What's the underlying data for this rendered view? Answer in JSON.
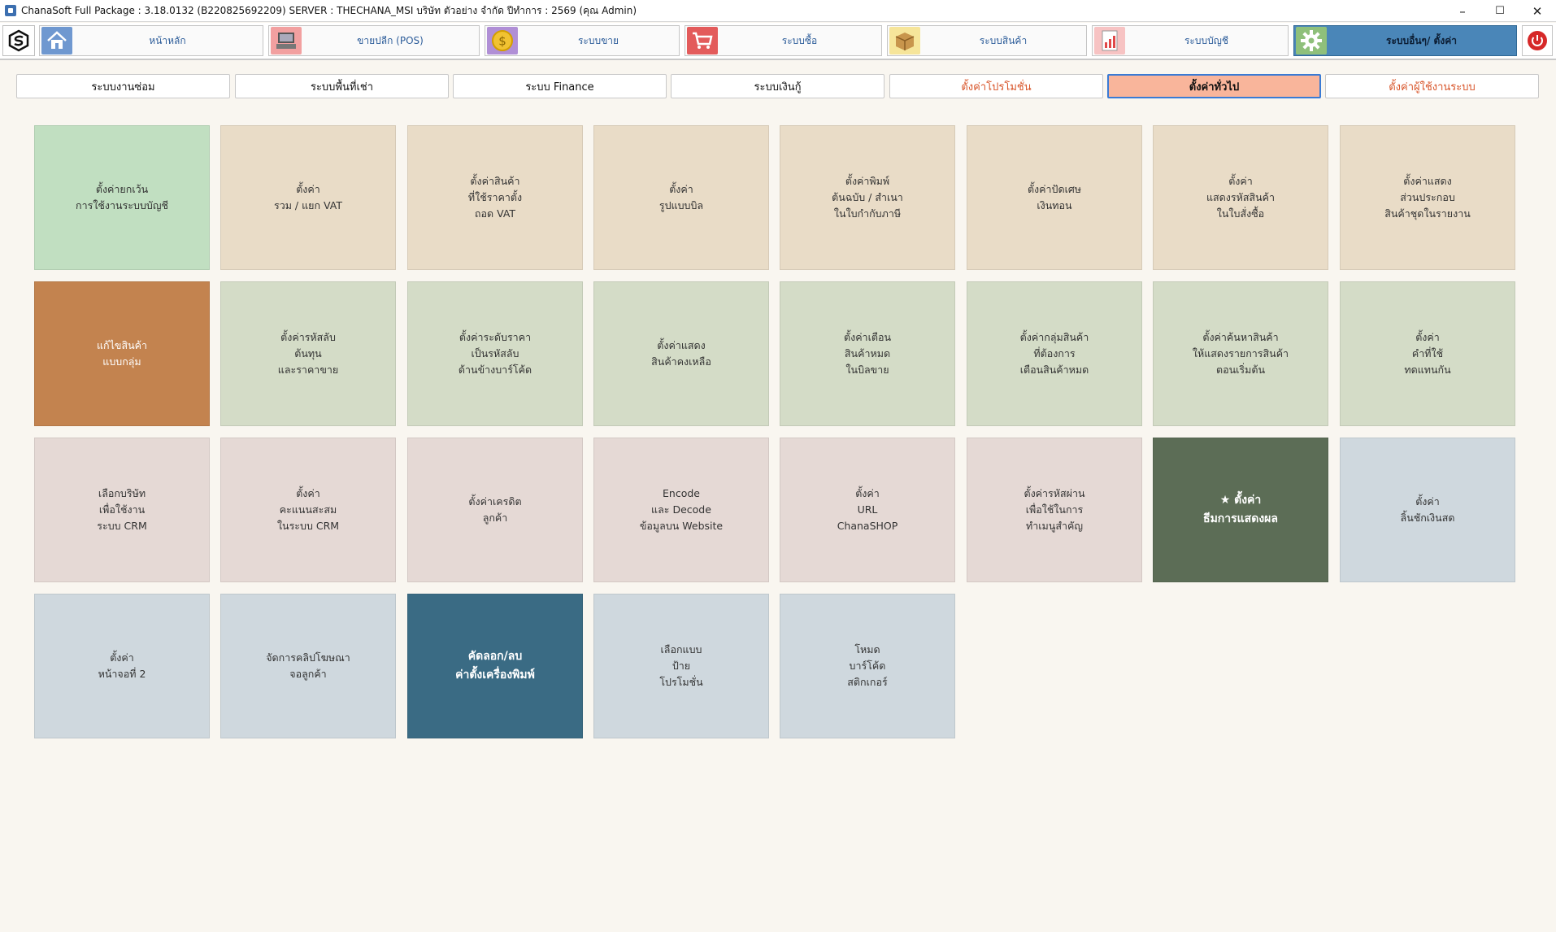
{
  "window": {
    "title": "ChanaSoft Full Package : 3.18.0132 (B220825692209) SERVER : THECHANA_MSI บริษัท ตัวอย่าง จำกัด ปีทำการ : 2569 (คุณ Admin)",
    "minimize": "–",
    "maximize": "☐",
    "close": "✕"
  },
  "nav": {
    "items": [
      {
        "label": "หน้าหลัก",
        "icon": "home-icon",
        "color": "#6f98d0"
      },
      {
        "label": "ขายปลีก (POS)",
        "icon": "pos-terminal-icon",
        "color": "#f2a0a0"
      },
      {
        "label": "ระบบขาย",
        "icon": "coin-icon",
        "color": "#b08fd6"
      },
      {
        "label": "ระบบซื้อ",
        "icon": "cart-icon",
        "color": "#e35b5b"
      },
      {
        "label": "ระบบสินค้า",
        "icon": "box-icon",
        "color": "#f6e59a"
      },
      {
        "label": "ระบบบัญชี",
        "icon": "report-icon",
        "color": "#f7c3c3"
      },
      {
        "label": "ระบบอื่นๆ/ ตั้งค่า",
        "icon": "gear-icon",
        "color": "#8fc07b"
      }
    ],
    "active_index": 6
  },
  "subtabs": [
    {
      "label": "ระบบงานซ่อม",
      "style": "normal"
    },
    {
      "label": "ระบบพื้นที่เช่า",
      "style": "normal"
    },
    {
      "label": "ระบบ Finance",
      "style": "normal"
    },
    {
      "label": "ระบบเงินกู้",
      "style": "normal"
    },
    {
      "label": "ตั้งค่าโปรโมชั่น",
      "style": "orange"
    },
    {
      "label": "ตั้งค่าทั่วไป",
      "style": "active"
    },
    {
      "label": "ตั้งค่าผู้ใช้งานระบบ",
      "style": "orange"
    }
  ],
  "tiles": [
    {
      "label": "ตั้งค่ายกเว้น\nการใช้งานระบบบัญชี",
      "color": "#c1dfc1"
    },
    {
      "label": "ตั้งค่า\nรวม / แยก VAT",
      "color": "#e9dcc7"
    },
    {
      "label": "ตั้งค่าสินค้า\nที่ใช้ราคาตั้ง\nถอด VAT",
      "color": "#e9dcc7"
    },
    {
      "label": "ตั้งค่า\nรูปแบบบิล",
      "color": "#e9dcc7"
    },
    {
      "label": "ตั้งค่าพิมพ์\nต้นฉบับ / สำเนา\nในใบกำกับภาษี",
      "color": "#e9dcc7"
    },
    {
      "label": "ตั้งค่าปัดเศษ\nเงินทอน",
      "color": "#e9dcc7"
    },
    {
      "label": "ตั้งค่า\nแสดงรหัสสินค้า\nในใบสั่งซื้อ",
      "color": "#e9dcc7"
    },
    {
      "label": "ตั้งค่าแสดง\nส่วนประกอบ\nสินค้าชุดในรายงาน",
      "color": "#e9dcc7"
    },
    {
      "label": "แก้ไขสินค้า\nแบบกลุ่ม",
      "color": "#c3834f",
      "text": "white"
    },
    {
      "label": "ตั้งค่ารหัสลับ\nต้นทุน\nและราคาขาย",
      "color": "#d4dcc7"
    },
    {
      "label": "ตั้งค่าระดับราคา\nเป็นรหัสลับ\nด้านข้างบาร์โค้ด",
      "color": "#d4dcc7"
    },
    {
      "label": "ตั้งค่าแสดง\nสินค้าคงเหลือ",
      "color": "#d4dcc7"
    },
    {
      "label": "ตั้งค่าเตือน\nสินค้าหมด\nในบิลขาย",
      "color": "#d4dcc7"
    },
    {
      "label": "ตั้งค่ากลุ่มสินค้า\nที่ต้องการ\nเตือนสินค้าหมด",
      "color": "#d4dcc7"
    },
    {
      "label": "ตั้งค่าค้นหาสินค้า\nให้แสดงรายการสินค้า\nตอนเริ่มต้น",
      "color": "#d4dcc7"
    },
    {
      "label": "ตั้งค่า\nคำที่ใช้\nทดแทนกัน",
      "color": "#d4dcc7"
    },
    {
      "label": "เลือกบริษัท\nเพื่อใช้งาน\nระบบ CRM",
      "color": "#e5d9d5"
    },
    {
      "label": "ตั้งค่า\nคะแนนสะสม\nในระบบ CRM",
      "color": "#e5d9d5"
    },
    {
      "label": "ตั้งค่าเครดิต\nลูกค้า",
      "color": "#e5d9d5"
    },
    {
      "label": "Encode\nและ Decode\nข้อมูลบน Website",
      "color": "#e5d9d5"
    },
    {
      "label": "ตั้งค่า\nURL\nChanaSHOP",
      "color": "#e5d9d5"
    },
    {
      "label": "ตั้งค่ารหัสผ่าน\nเพื่อใช้ในการ\nทำเมนูสำคัญ",
      "color": "#e5d9d5"
    },
    {
      "label": "★ ตั้งค่า\nธีมการแสดงผล",
      "color": "#5c6d56",
      "text": "bold"
    },
    {
      "label": "ตั้งค่า\nลิ้นชักเงินสด",
      "color": "#cfd8de"
    },
    {
      "label": "ตั้งค่า\nหน้าจอที่ 2",
      "color": "#cfd8de"
    },
    {
      "label": "จัดการคลิปโฆษณา\nจอลูกค้า",
      "color": "#cfd8de"
    },
    {
      "label": "คัดลอก/ลบ\nค่าตั้งเครื่องพิมพ์",
      "color": "#3a6b84",
      "text": "bold"
    },
    {
      "label": "เลือกแบบ\nป้าย\nโปรโมชั่น",
      "color": "#cfd8de"
    },
    {
      "label": "โหมด\nบาร์โค้ด\nสติกเกอร์",
      "color": "#cfd8de"
    }
  ]
}
